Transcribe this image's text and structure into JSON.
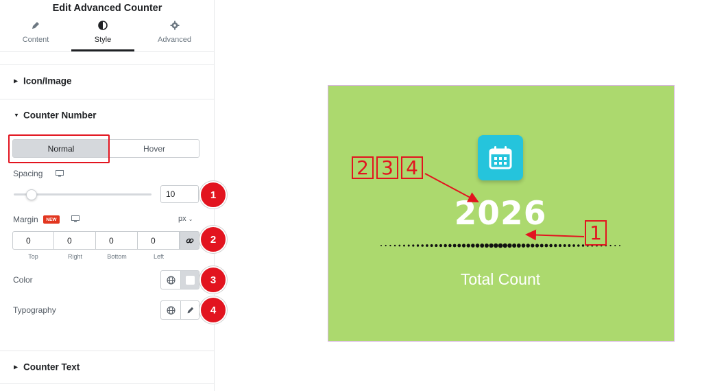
{
  "panel": {
    "title": "Edit Advanced Counter",
    "tabs": [
      {
        "label": "Content",
        "icon": "pencil-icon"
      },
      {
        "label": "Style",
        "icon": "half-circle-icon",
        "active": true
      },
      {
        "label": "Advanced",
        "icon": "gear-icon"
      }
    ],
    "sections": {
      "icon_image": "Icon/Image",
      "counter_number": "Counter Number",
      "counter_text": "Counter Text"
    },
    "state_toggle": {
      "normal": "Normal",
      "hover": "Hover",
      "selected": "Normal"
    },
    "spacing": {
      "label": "Spacing",
      "value": "10",
      "slider_fraction": 0.1
    },
    "margin": {
      "label": "Margin",
      "badge": "NEW",
      "unit": "px",
      "values": [
        "0",
        "0",
        "0",
        "0"
      ],
      "sides": [
        "Top",
        "Right",
        "Bottom",
        "Left"
      ]
    },
    "color": {
      "label": "Color",
      "swatch": "#ffffff"
    },
    "typography": {
      "label": "Typography"
    }
  },
  "markers": [
    "1",
    "2",
    "3",
    "4"
  ],
  "preview": {
    "number": "2026",
    "text": "Total Count",
    "background": "#acd96e",
    "icon_color": "#25c4dc",
    "icon": "calendar-icon",
    "labels": [
      "2",
      "3",
      "4",
      "1"
    ]
  },
  "colors": {
    "accent_red": "#e2141f",
    "panel_text": "#1f2124"
  }
}
